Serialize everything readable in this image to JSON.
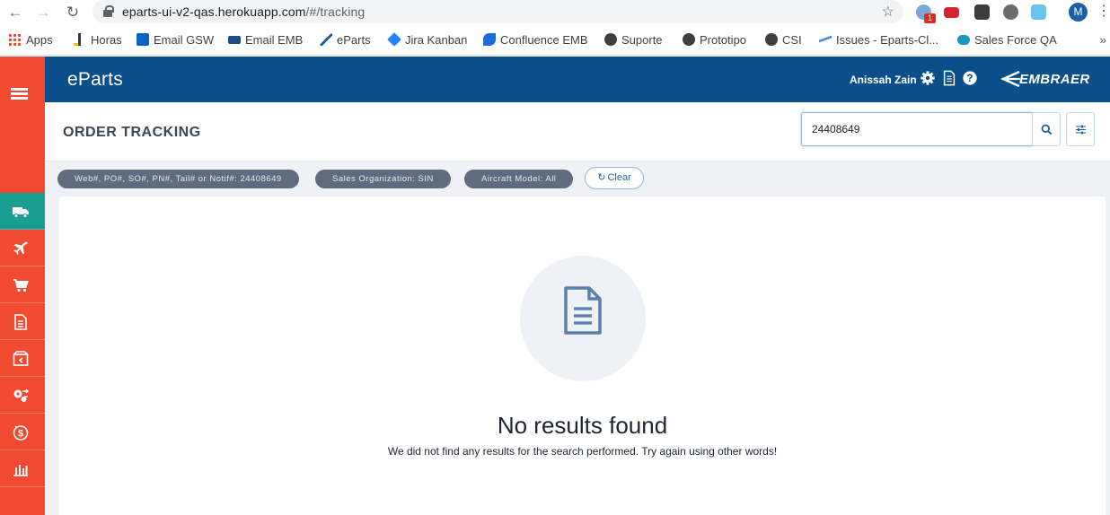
{
  "browser": {
    "url_host": "eparts-ui-v2-qas.herokuapp.com",
    "url_path": "/#/tracking",
    "extension_badge": "1",
    "profile_initial": "M",
    "bookmarks": [
      {
        "label": "Apps"
      },
      {
        "label": "Horas"
      },
      {
        "label": "Email GSW"
      },
      {
        "label": "Email EMB"
      },
      {
        "label": "eParts"
      },
      {
        "label": "Jira Kanban"
      },
      {
        "label": "Confluence EMB"
      },
      {
        "label": "Suporte"
      },
      {
        "label": "Prototipo"
      },
      {
        "label": "CSI"
      },
      {
        "label": "Issues - Eparts-Cl..."
      },
      {
        "label": "Sales Force QA"
      }
    ],
    "more_label": "»"
  },
  "header": {
    "brand": "eParts",
    "user_name": "Anissah Zain",
    "logo_text": "EMBRAER"
  },
  "page": {
    "title": "ORDER TRACKING",
    "search_value": "24408649"
  },
  "filters": {
    "chips": [
      {
        "label": "Web#, PO#, SO#, PN#, Tail# or Notif#: 24408649"
      },
      {
        "label": "Sales Organization: SIN"
      },
      {
        "label": "Aircraft Model: All"
      }
    ],
    "clear_label": "Clear"
  },
  "empty_state": {
    "title": "No results found",
    "message": "We did not find any results for the search performed. Try again using other words!"
  },
  "colors": {
    "sidebar": "#f04a32",
    "sidebar_active": "#1a9d92",
    "header": "#0b4f8a",
    "chip": "#5f6b7f",
    "accent": "#2566a8"
  },
  "sidebar_icons": [
    "truck-icon",
    "airplane-icon",
    "cart-icon",
    "document-icon",
    "box-exchange-icon",
    "gears-exchange-icon",
    "dollar-icon",
    "bar-chart-icon"
  ]
}
